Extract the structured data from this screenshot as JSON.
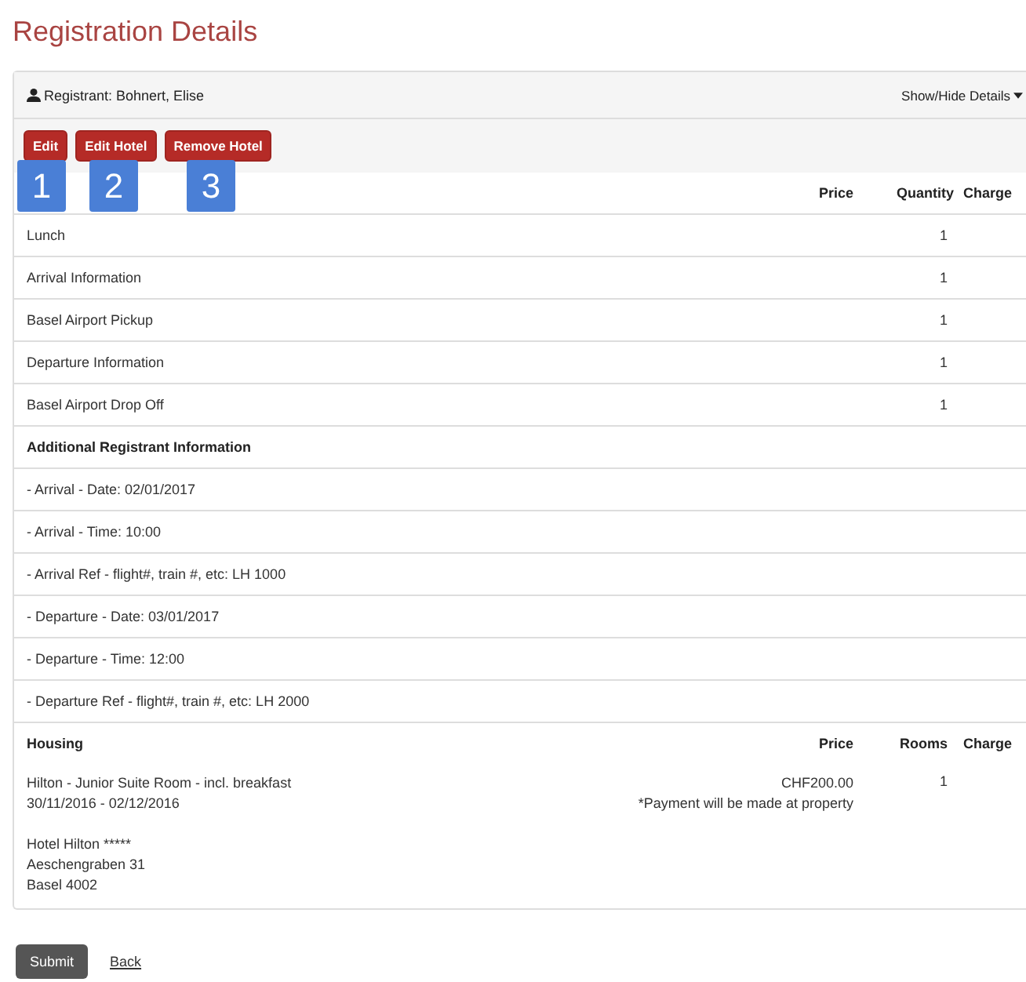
{
  "title": "Registration Details",
  "registrant": {
    "label": "Registrant: Bohnert, Elise",
    "toggle": "Show/Hide Details"
  },
  "buttons": [
    "Edit",
    "Edit Hotel",
    "Remove Hotel"
  ],
  "callouts": [
    "1",
    "2",
    "3"
  ],
  "items_table": {
    "columns": [
      "Price",
      "Quantity",
      "Charge"
    ],
    "rows": [
      {
        "name": "Lunch",
        "quantity": "1"
      },
      {
        "name": "Arrival Information",
        "quantity": "1"
      },
      {
        "name": "Basel Airport Pickup",
        "quantity": "1"
      },
      {
        "name": "Departure Information",
        "quantity": "1"
      },
      {
        "name": "Basel Airport Drop Off",
        "quantity": "1"
      }
    ]
  },
  "additional": {
    "heading": "Additional Registrant Information",
    "rows": [
      "- Arrival - Date: 02/01/2017",
      "- Arrival - Time: 10:00",
      "- Arrival Ref - flight#, train #, etc: LH 1000",
      "- Departure - Date: 03/01/2017",
      "- Departure - Time: 12:00",
      "- Departure Ref - flight#, train #, etc: LH 2000"
    ]
  },
  "housing": {
    "columns": [
      "Housing",
      "Price",
      "Rooms",
      "Charge"
    ],
    "booking": {
      "room": "Hilton - Junior Suite Room - incl. breakfast",
      "dates": "30/11/2016 - 02/12/2016",
      "price": "CHF200.00",
      "note": "*Payment will be made at property",
      "rooms": "1"
    },
    "hotel": [
      "Hotel Hilton *****",
      "Aeschengraben 31",
      "Basel 4002"
    ]
  },
  "actions": {
    "submit": "Submit",
    "back": "Back"
  }
}
